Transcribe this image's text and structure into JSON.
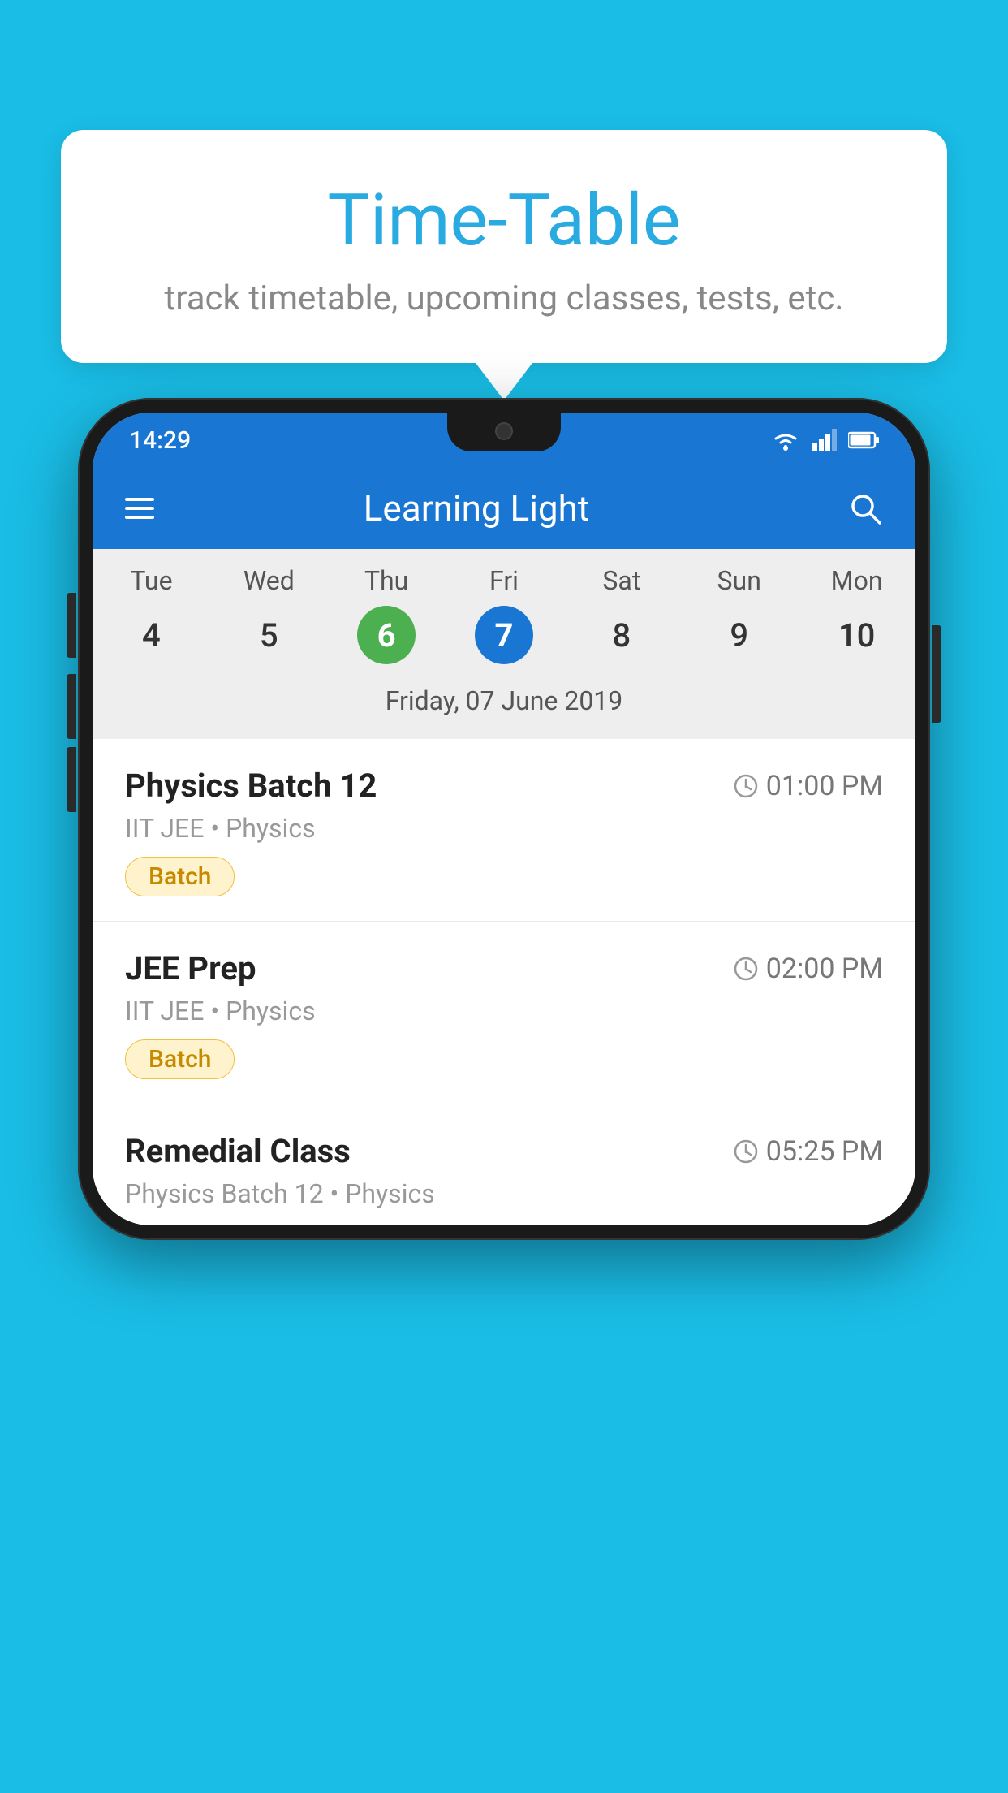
{
  "background_color": "#1ABDE6",
  "bubble": {
    "title": "Time-Table",
    "subtitle": "track timetable, upcoming classes, tests, etc."
  },
  "phone": {
    "status_bar": {
      "time": "14:29",
      "icons": [
        "wifi",
        "signal",
        "battery"
      ]
    },
    "app_bar": {
      "title": "Learning Light"
    },
    "calendar": {
      "days": [
        "Tue",
        "Wed",
        "Thu",
        "Fri",
        "Sat",
        "Sun",
        "Mon"
      ],
      "dates": [
        "4",
        "5",
        "6",
        "7",
        "8",
        "9",
        "10"
      ],
      "today_index": 2,
      "selected_index": 3,
      "selected_date_label": "Friday, 07 June 2019"
    },
    "schedule": [
      {
        "title": "Physics Batch 12",
        "time": "01:00 PM",
        "subtitle": "IIT JEE • Physics",
        "badge": "Batch"
      },
      {
        "title": "JEE Prep",
        "time": "02:00 PM",
        "subtitle": "IIT JEE • Physics",
        "badge": "Batch"
      },
      {
        "title": "Remedial Class",
        "time": "05:25 PM",
        "subtitle": "Physics Batch 12 • Physics",
        "badge": null
      }
    ]
  }
}
